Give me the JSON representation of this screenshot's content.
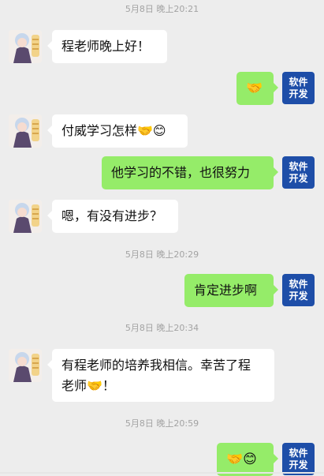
{
  "messages": {
    "t1": "5月8日 晚上20:21",
    "m1": "程老师晚上好！",
    "m2": "🤝",
    "m3": "付威学习怎样🤝😊",
    "m4": "他学习的不错，也很努力",
    "m5": "嗯，有没有进步？",
    "t2": "5月8日 晚上20:29",
    "m6": "肯定进步啊",
    "t3": "5月8日 晚上20:34",
    "m7a": "有程老师的培养我相信。幸苦了程",
    "m7b": "老师🤝！",
    "t4": "5月8日 晚上20:59",
    "m8": "🤝😊"
  },
  "self_avatar": {
    "line1": "软件",
    "line2": "开发",
    "color": "#1e4ea8"
  },
  "colors": {
    "background": "#ededed",
    "left_bubble": "#ffffff",
    "right_bubble": "#95ec69"
  }
}
